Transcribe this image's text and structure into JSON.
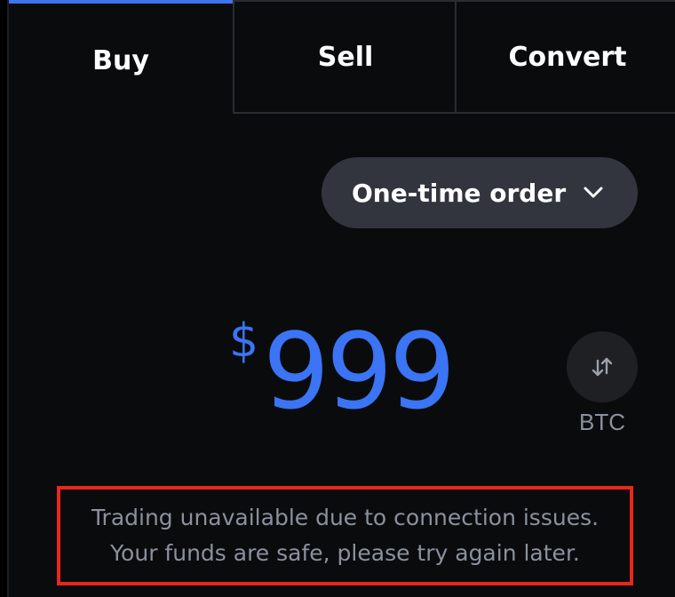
{
  "tabs": {
    "buy": "Buy",
    "sell": "Sell",
    "convert": "Convert",
    "active": "Buy",
    "accent_color": "#3e73f0"
  },
  "order_type": {
    "label": "One-time order",
    "icon": "chevron-down-icon"
  },
  "amount": {
    "currency_symbol": "$",
    "value": "999",
    "color": "#3b74f4"
  },
  "swap": {
    "icon": "swap-arrows-icon",
    "label": "BTC"
  },
  "message": {
    "line1": "Trading unavailable due to connection issues.",
    "line2": "Your funds are safe, please try again later.",
    "highlight_color": "#e8271b"
  }
}
